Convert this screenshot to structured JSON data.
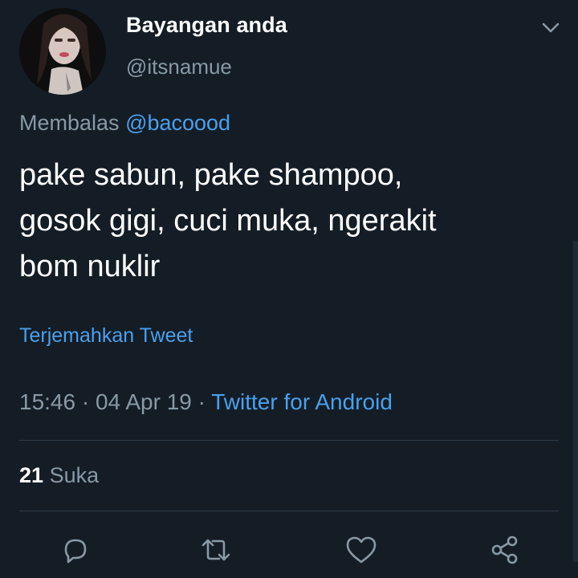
{
  "tweet": {
    "author_name": "Bayangan anda",
    "author_handle": "@itsnamue",
    "reply_prefix": "Membalas",
    "reply_to": "@bacoood",
    "text_lines": [
      "pake sabun, pake shampoo,",
      "gosok gigi, cuci muka, ngerakit",
      "bom nuklir"
    ],
    "translate_label": "Terjemahkan Tweet",
    "time": "15:46",
    "separator": " · ",
    "date": "04 Apr 19",
    "source": "Twitter for Android",
    "likes_count": "21",
    "likes_label": "Suka"
  },
  "icons": {
    "menu": "chevron-down-icon",
    "reply": "reply-icon",
    "retweet": "retweet-icon",
    "like": "heart-icon",
    "share": "share-icon"
  },
  "colors": {
    "background": "#141d26",
    "text": "#ffffff",
    "secondary": "#8899a6",
    "accent": "#4aa0ec",
    "divider": "#2f3d4a"
  }
}
